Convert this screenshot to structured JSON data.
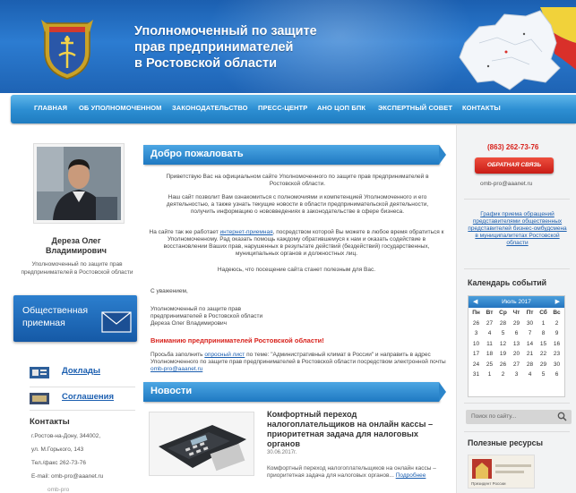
{
  "header": {
    "title_lines": [
      "Уполномоченный по защите",
      "прав предпринимателей",
      "в Ростовской области"
    ],
    "coat_icon": "coat-of-arms-icon",
    "map_icon": "region-map-icon"
  },
  "nav": {
    "items": [
      "Главная",
      "Об уполномоченном",
      "Законодательство",
      "Пресс-центр",
      "АНО ЦОП БПК",
      "Экспертный совет",
      "Контакты"
    ]
  },
  "left": {
    "person_name_1": "Дереза Олег",
    "person_name_2": "Владимирович",
    "person_role": "Уполномоченный по защите прав предпринимателей в Ростовской области",
    "reception_line1": "Общественная",
    "reception_line2": "приемная",
    "links": [
      "Доклады",
      "Соглашения"
    ],
    "contacts_title": "Контакты",
    "contacts": [
      "г.Ростов-на-Дону, 344002,",
      "ул. М.Горького, 143",
      "Тел./факс 262-73-76",
      "E-mail: omb-pro@aaanet.ru",
      "omb-pro"
    ]
  },
  "welcome": {
    "title": "Добро пожаловать",
    "para1": "Приветствую Вас на официальном сайте Уполномоченного по защите прав предпринимателей в Ростовской области.",
    "para2": "Наш сайт позволит Вам ознакомиться с полномочиями и компетенцией Уполномоченного и его деятельностью, а также узнать текущие новости в области предпринимательской деятельности, получить информацию о нововведениях в законодательстве в сфере бизнеса.",
    "para3_pre": "На сайте так же работает ",
    "para3_link": "интернет-приемная",
    "para3_post": ", посредством которой Вы можете в любое время обратиться к Уполномоченному. Рад оказать помощь каждому обратившемуся к нам и оказать содействие в восстановлении Ваших прав, нарушенных в результате действий (бездействий) государственных, муниципальных органов и должностных лиц.",
    "para4": "Надеюсь, что посещение сайта станет полезным для Вас.",
    "regards": "С уважением,",
    "sign1": "Уполномоченный по защите прав",
    "sign2": "предпринимателей в Ростовской области",
    "sign3": "Дереза Олег Владимирович",
    "warning": "Вниманию предпринимателей Ростовской области!",
    "survey_pre": "Просьба заполнить ",
    "survey_link": "опросный лист",
    "survey_mid": " по теме: \"Административный климат в России\" и направить в адрес Уполномоченного по защите прав предпринимателей в Ростовской области посредством электронной почты ",
    "survey_email": "omb-pro@aaanet.ru"
  },
  "news": {
    "title": "Новости",
    "item_title": "Комфортный переход налогоплательщиков на онлайн кассы – приоритетная задача для налоговых органов",
    "item_date": "30.06.2017г.",
    "item_excerpt": "Комфортный переход налогоплательщиков на онлайн кассы – приоритетная задача для налоговых органов... ",
    "item_more": "Подробнее"
  },
  "right": {
    "phone": "(863) 262-73-76",
    "feedback_label": "ОБРАТНАЯ СВЯЗЬ",
    "email": "omb-pro@aaanet.ru",
    "schedule_link": "График приема обращений представителями общественных представителей бизнес-омбудсмена в муниципалитетах Ростовской области",
    "calendar_title": "Календарь событий",
    "calendar_month": "Июль 2017",
    "calendar_days_header": [
      "Пн",
      "Вт",
      "Ср",
      "Чт",
      "Пт",
      "Сб",
      "Вс"
    ],
    "calendar_days": [
      "26",
      "27",
      "28",
      "29",
      "30",
      "1",
      "2",
      "3",
      "4",
      "5",
      "6",
      "7",
      "8",
      "9",
      "10",
      "11",
      "12",
      "13",
      "14",
      "15",
      "16",
      "17",
      "18",
      "19",
      "20",
      "21",
      "22",
      "23",
      "24",
      "25",
      "26",
      "27",
      "28",
      "29",
      "30",
      "31",
      "1",
      "2",
      "3",
      "4",
      "5",
      "6"
    ],
    "search_placeholder": "Поиск по сайту...",
    "resources_title": "Полезные ресурсы",
    "resource_caption": "Президент России"
  },
  "colors": {
    "header_blue": "#1e63b4",
    "nav_blue": "#2d8fd3",
    "warning_red": "#d8221c",
    "link_blue": "#1c5fb0"
  }
}
